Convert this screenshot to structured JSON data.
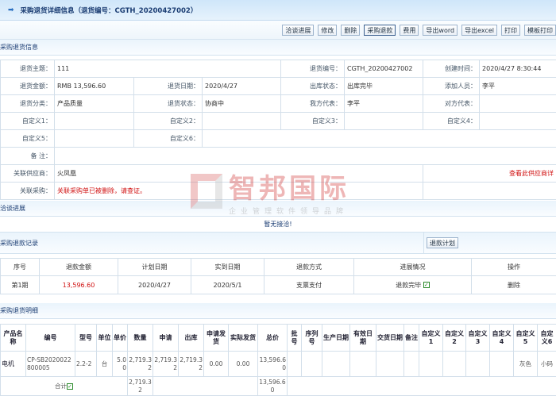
{
  "title": "采购退货详细信息（退货编号：CGTH_20200427002）",
  "toolbar": [
    "洽谈进展",
    "修改",
    "删除",
    "采购退款",
    "费用",
    "导出word",
    "导出excel",
    "打印",
    "模板打印"
  ],
  "info": {
    "section": "采购退货信息",
    "rows": [
      [
        [
          "退货主题：",
          "111"
        ],
        [
          "退货编号：",
          "CGTH_20200427002"
        ],
        [
          "创建时间：",
          "2020/4/27 8:30:44"
        ]
      ],
      [
        [
          "退货金额：",
          "RMB 13,596.60"
        ],
        [
          "退货日期：",
          "2020/4/27"
        ],
        [
          "出库状态：",
          "出库完毕"
        ],
        [
          "添加人员：",
          "李平"
        ]
      ],
      [
        [
          "退货分类：",
          "产品质量"
        ],
        [
          "退货状态：",
          "协商中"
        ],
        [
          "我方代表：",
          "李平"
        ],
        [
          "对方代表：",
          ""
        ]
      ],
      [
        [
          "自定义1：",
          ""
        ],
        [
          "自定义2：",
          ""
        ],
        [
          "自定义3：",
          ""
        ],
        [
          "自定义4：",
          ""
        ]
      ],
      [
        [
          "自定义5：",
          ""
        ],
        [
          "自定义6：",
          ""
        ]
      ]
    ],
    "remark_label": "备 注：",
    "supplier_label": "关联供应商：",
    "supplier": "火凤凰",
    "supplier_link": "查看此供应商详",
    "purchase_label": "关联采购：",
    "purchase_msg": "关联采购单已被删除，请查证。"
  },
  "negotiation": {
    "section": "洽谈进展",
    "empty": "暂无接洽!"
  },
  "refund": {
    "section": "采购退款记录",
    "plan_button": "退款计划",
    "headers": [
      "序号",
      "退款金额",
      "计划日期",
      "实到日期",
      "退款方式",
      "进展情况",
      "操作"
    ],
    "rows": [
      [
        "第1期",
        "13,596.60",
        "2020/4/27",
        "2020/5/1",
        "支票支付",
        "退款完毕",
        "删除"
      ]
    ]
  },
  "detail": {
    "section": "采购退货明细",
    "headers": [
      "产品名称",
      "编号",
      "型号",
      "单位",
      "单价",
      "数量",
      "申请",
      "出库",
      "申请发货",
      "实际发货",
      "总价",
      "批号",
      "序列号",
      "生产日期",
      "有效日期",
      "交货日期",
      "备注",
      "自定义1",
      "自定义2",
      "自定义3",
      "自定义4",
      "自定义5",
      "自定义6"
    ],
    "rows": [
      [
        "电机",
        "CP-SB2020022800005",
        "2.2-2",
        "台",
        "5.00",
        "2,719.32",
        "2,719.32",
        "2,719.32",
        "0.00",
        "0.00",
        "13,596.60",
        "",
        "",
        "",
        "",
        "",
        "",
        "",
        "",
        "",
        "",
        "灰色",
        "小码"
      ]
    ],
    "total_label": "合计",
    "total_qty": "2,719.32",
    "total_price": "13,596.60"
  },
  "watermark": {
    "name": "智邦国际",
    "slogan": "企业管理软件领导品牌"
  },
  "colors": {
    "accent": "#1b3d73",
    "alert": "#d01010"
  }
}
